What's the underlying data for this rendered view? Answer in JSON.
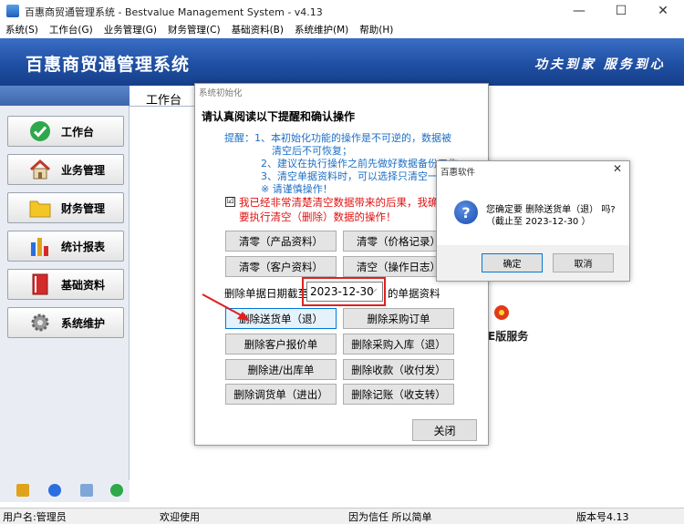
{
  "window": {
    "title": "百惠商贸通管理系统 - Bestvalue Management System - v4.13",
    "controls": [
      "—",
      "☐",
      "✕"
    ]
  },
  "menu": [
    "系统(S)",
    "工作台(G)",
    "业务管理(G)",
    "财务管理(C)",
    "基础资料(B)",
    "系统维护(M)",
    "帮助(H)"
  ],
  "banner": {
    "title": "百惠商贸通管理系统",
    "slogan": "功夫到家 服务到心"
  },
  "sidebar": {
    "items": [
      {
        "label": "工作台",
        "icon": "check-icon"
      },
      {
        "label": "业务管理",
        "icon": "house-icon"
      },
      {
        "label": "财务管理",
        "icon": "folder-icon"
      },
      {
        "label": "统计报表",
        "icon": "bar-chart-icon"
      },
      {
        "label": "基础资料",
        "icon": "book-icon"
      },
      {
        "label": "系统维护",
        "icon": "gear-icon"
      }
    ]
  },
  "main": {
    "tab_label": "工作台",
    "version_service": "E版服务"
  },
  "statusbar": {
    "user": "用户名:管理员",
    "welcome": "欢迎使用",
    "motto": "因为信任 所以简单",
    "version": "版本号4.13"
  },
  "init_dialog": {
    "title": "系统初始化",
    "heading": "请认真阅读以下提醒和确认操作",
    "tips": [
      "提醒：1、本初始化功能的操作是不可逆的，数据被",
      "清空后不可恢复；",
      "2、建议在执行操作之前先做好数据备份工作",
      "3、清空单据资料时，可以选择只清空一",
      "※  请谨慎操作！"
    ],
    "checkbox_mark": "☑",
    "warning_lines": [
      "我已经非常清楚清空数据带来的后果，我确认",
      "要执行清空（删除）数据的操作！"
    ],
    "clear_buttons": [
      "清零（产品资料）",
      "清零（价格记录）",
      "清零（客户资料）",
      "清空（操作日志）"
    ],
    "date_label": "删除单据日期截至",
    "date_value": "2023-12-30",
    "date_suffix": "的单据资料",
    "delete_buttons": [
      "删除送货单（退）",
      "删除采购订单",
      "删除客户报价单",
      "删除采购入库（退）",
      "删除进/出库单",
      "删除收款（收付发）",
      "删除调货单（进出）",
      "删除记账（收支转）"
    ],
    "close_label": "关闭"
  },
  "confirm_dialog": {
    "title": "百惠软件",
    "message": "您确定要 删除送货单（退） 吗?",
    "sub": "（截止至 2023-12-30 ）",
    "ok_label": "确定",
    "cancel_label": "取消"
  },
  "colors": {
    "banner": "#1f4fa3",
    "tip_text": "#1d6fc5",
    "warning_text": "#e01010",
    "highlight": "#e02020"
  }
}
